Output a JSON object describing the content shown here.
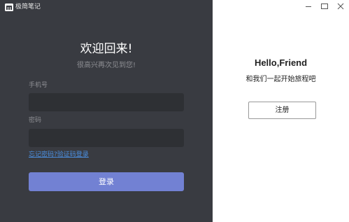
{
  "app": {
    "name": "极简笔记"
  },
  "window_controls": {
    "minimize_icon": "minimize-icon",
    "maximize_icon": "maximize-icon",
    "close_icon": "close-icon"
  },
  "login": {
    "title": "欢迎回来!",
    "subtitle": "很高兴再次见到您!",
    "phone_label": "手机号",
    "phone_value": "",
    "phone_placeholder": "",
    "password_label": "密码",
    "password_value": "",
    "password_placeholder": "",
    "forgot_password_link": "忘记密码?",
    "sms_login_link": "验证码登录",
    "submit_label": "登录"
  },
  "register_panel": {
    "title": "Hello,Friend",
    "subtitle": "和我们一起开始旅程吧",
    "register_label": "注册"
  },
  "colors": {
    "left_panel_bg": "#393b41",
    "input_bg": "#2e3034",
    "primary_button": "#7281d3",
    "link": "#4b8fe0",
    "right_panel_bg": "#ffffff"
  }
}
